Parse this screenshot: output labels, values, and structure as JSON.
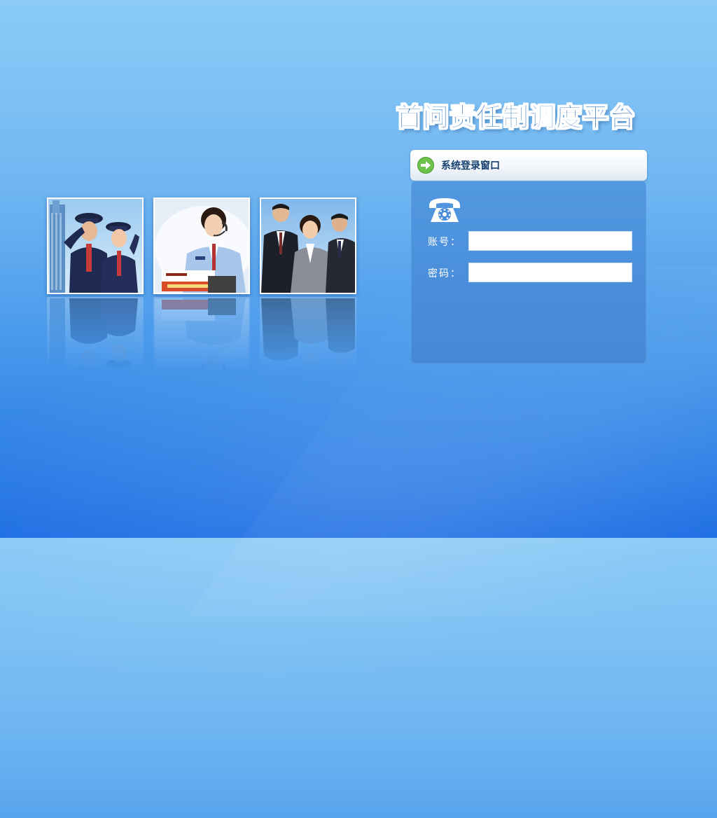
{
  "page": {
    "title": "首问责任制调度平台"
  },
  "login": {
    "header_label": "系统登录窗口",
    "account_label": "账号：",
    "account_value": "",
    "password_label": "密码：",
    "password_value": ""
  },
  "photos": [
    {
      "subject": "uniformed staff saluting"
    },
    {
      "subject": "customer service operator with headset"
    },
    {
      "subject": "business team in suits"
    }
  ],
  "colors": {
    "background_top": "#8ccbf6",
    "background_bottom": "#1f6fe4",
    "title": "#1b64b8",
    "panel": "#4a8edb",
    "arrow_icon": "#6cc24a"
  },
  "icons": {
    "header": "arrow-right-icon",
    "panel": "telephone-icon"
  }
}
